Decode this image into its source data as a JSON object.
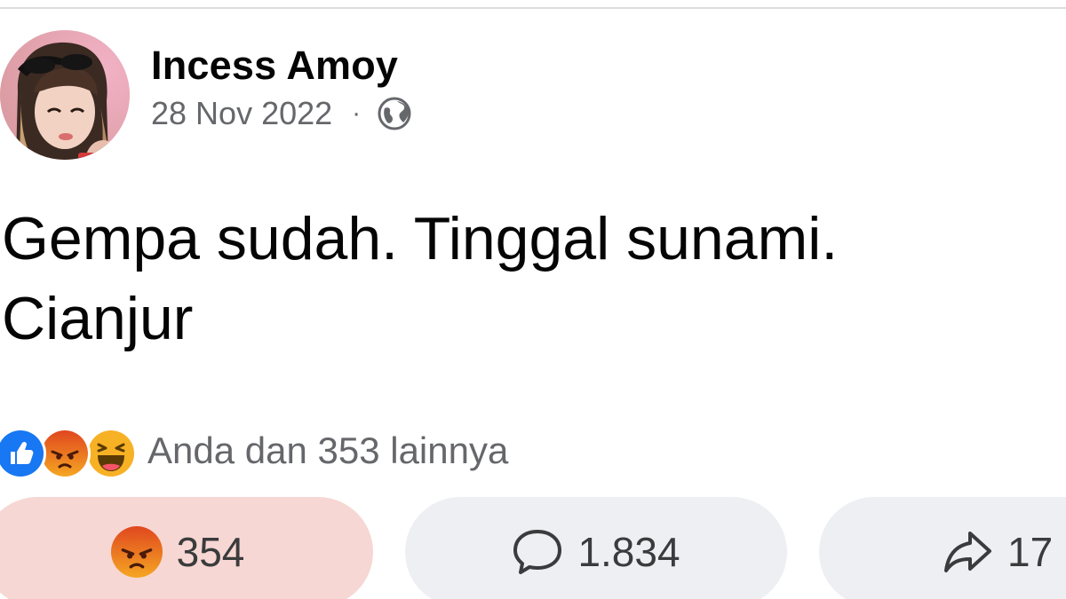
{
  "post": {
    "author_name": "Incess Amoy",
    "date": "28 Nov 2022",
    "meta_separator": "·",
    "audience_icon": "globe-icon",
    "text": "Gempa sudah. Tinggal sunami.\nCianjur"
  },
  "reactions": {
    "icons": [
      "like-icon",
      "angry-icon",
      "haha-icon"
    ],
    "summary": "Anda dan 353 lainnya"
  },
  "actions": {
    "react": {
      "icon": "angry-icon",
      "count": "354",
      "state": "active"
    },
    "comment": {
      "icon": "comment-icon",
      "count": "1.834"
    },
    "share": {
      "icon": "share-icon",
      "count": "17"
    }
  },
  "colors": {
    "like_blue": "#1877f2",
    "angry_orange": "#e9710f",
    "haha_yellow": "#f7b125",
    "active_button_bg": "#f6d7d3",
    "button_bg": "#eeeff3",
    "secondary_text": "#65676b"
  }
}
